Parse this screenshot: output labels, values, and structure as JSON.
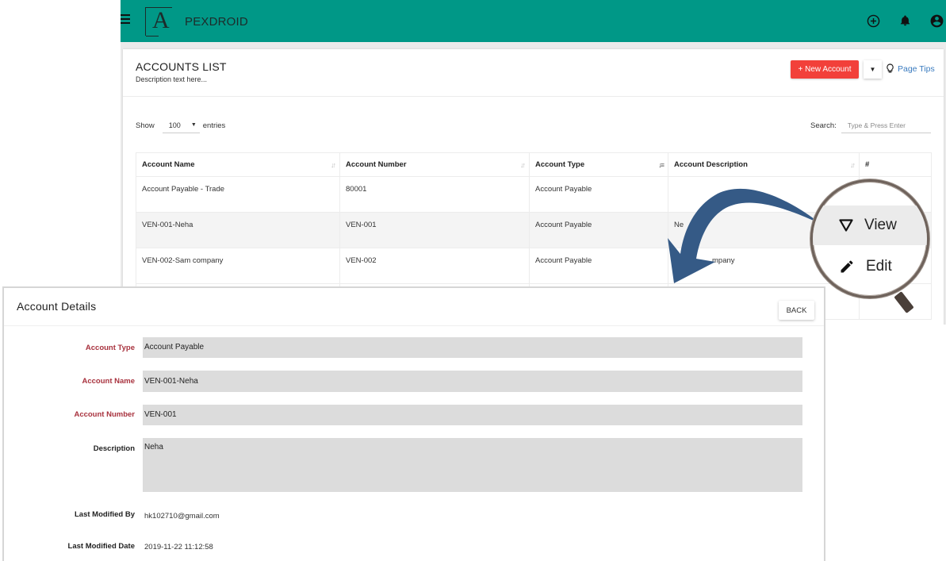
{
  "app": {
    "brand_initial": "A",
    "brand_name": "PEXDROID",
    "header_color": "#009887",
    "icons": [
      "menu-icon",
      "add-circle-icon",
      "bell-icon",
      "account-circle-icon"
    ]
  },
  "accounts_list": {
    "title": "ACCOUNTS LIST",
    "description": "Description text here...",
    "new_button": "+ New Account",
    "new_button_color": "#f2403a",
    "page_tips": "Page Tips",
    "show_label": "Show",
    "show_value": "100",
    "entries_label": "entries",
    "search_label": "Search:",
    "search_placeholder": "Type & Press Enter",
    "columns": [
      {
        "label": "Account Name",
        "sort": "unsorted"
      },
      {
        "label": "Account Number",
        "sort": "unsorted"
      },
      {
        "label": "Account Type",
        "sort": "ascending"
      },
      {
        "label": "Account Description",
        "sort": "unsorted"
      },
      {
        "label": "#",
        "sort": "none"
      }
    ],
    "rows": [
      {
        "name": "Account Payable - Trade",
        "number": "80001",
        "type": "Account Payable",
        "description": ""
      },
      {
        "name": "VEN-001-Neha",
        "number": "VEN-001",
        "type": "Account Payable",
        "description": "Ne"
      },
      {
        "name": "VEN-002-Sam company",
        "number": "VEN-002",
        "type": "Account Payable",
        "description": "mpany"
      }
    ]
  },
  "magnifier": {
    "view_label": "View",
    "edit_label": "Edit"
  },
  "details": {
    "title": "Account Details",
    "back_label": "BACK",
    "fields": {
      "account_type": {
        "label": "Account Type",
        "value": "Account Payable"
      },
      "account_name": {
        "label": "Account Name",
        "value": "VEN-001-Neha"
      },
      "account_number": {
        "label": "Account Number",
        "value": "VEN-001"
      },
      "description": {
        "label": "Description",
        "value": "Neha"
      },
      "last_modified_by": {
        "label": "Last Modified By",
        "value": "hk102710@gmail.com"
      },
      "last_modified_date": {
        "label": "Last Modified Date",
        "value": "2019-11-22 11:12:58"
      }
    },
    "required_label_color": "#a8323e"
  }
}
